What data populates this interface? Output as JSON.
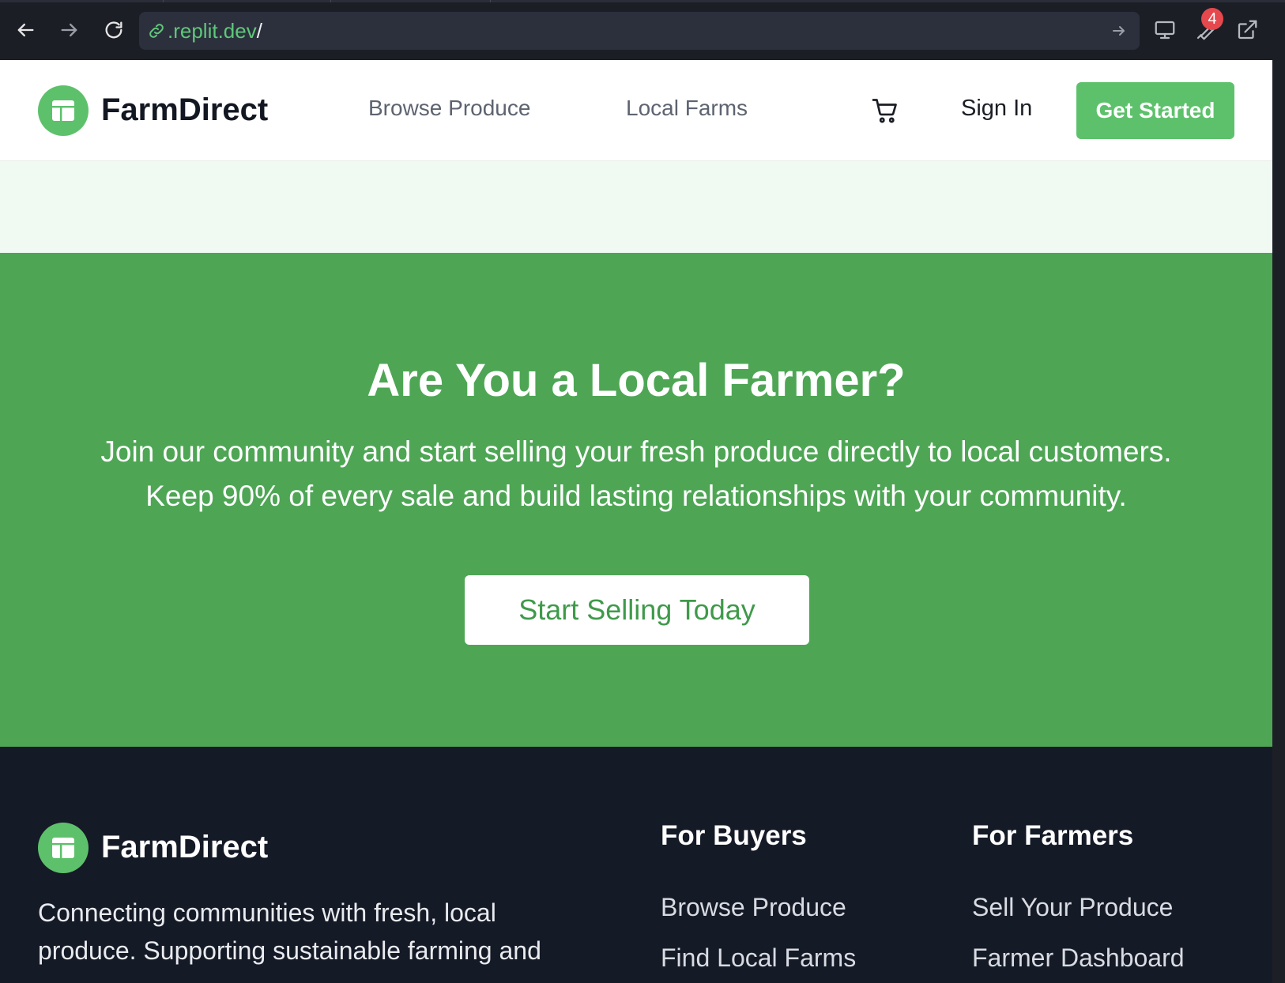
{
  "browser": {
    "url_domain": ".replit.dev",
    "url_path": "/",
    "notification_count": "4",
    "icons": [
      "back-arrow-icon",
      "forward-arrow-icon",
      "reload-icon",
      "link-icon",
      "go-arrow-icon",
      "monitor-icon",
      "wrench-icon",
      "external-link-icon"
    ]
  },
  "header": {
    "brand": "FarmDirect",
    "nav": [
      "Browse Produce",
      "Local Farms"
    ],
    "sign_in": "Sign In",
    "get_started": "Get Started"
  },
  "cta": {
    "title": "Are You a Local Farmer?",
    "subtitle_line1": "Join our community and start selling your fresh produce directly to local customers.",
    "subtitle_line2": "Keep 90% of every sale and build lasting relationships with your community.",
    "button": "Start Selling Today"
  },
  "footer": {
    "brand": "FarmDirect",
    "description_line1": "Connecting communities with fresh, local",
    "description_line2": "produce. Supporting sustainable farming and",
    "buyers": {
      "heading": "For Buyers",
      "links": [
        "Browse Produce",
        "Find Local Farms"
      ]
    },
    "farmers": {
      "heading": "For Farmers",
      "links": [
        "Sell Your Produce",
        "Farmer Dashboard"
      ]
    }
  },
  "colors": {
    "brand_green": "#5dc16b",
    "cta_green": "#4ea655",
    "mint": "#f0faf3",
    "footer_bg": "#151a27",
    "url_green": "#5fc77a",
    "badge_red": "#e5484d"
  }
}
